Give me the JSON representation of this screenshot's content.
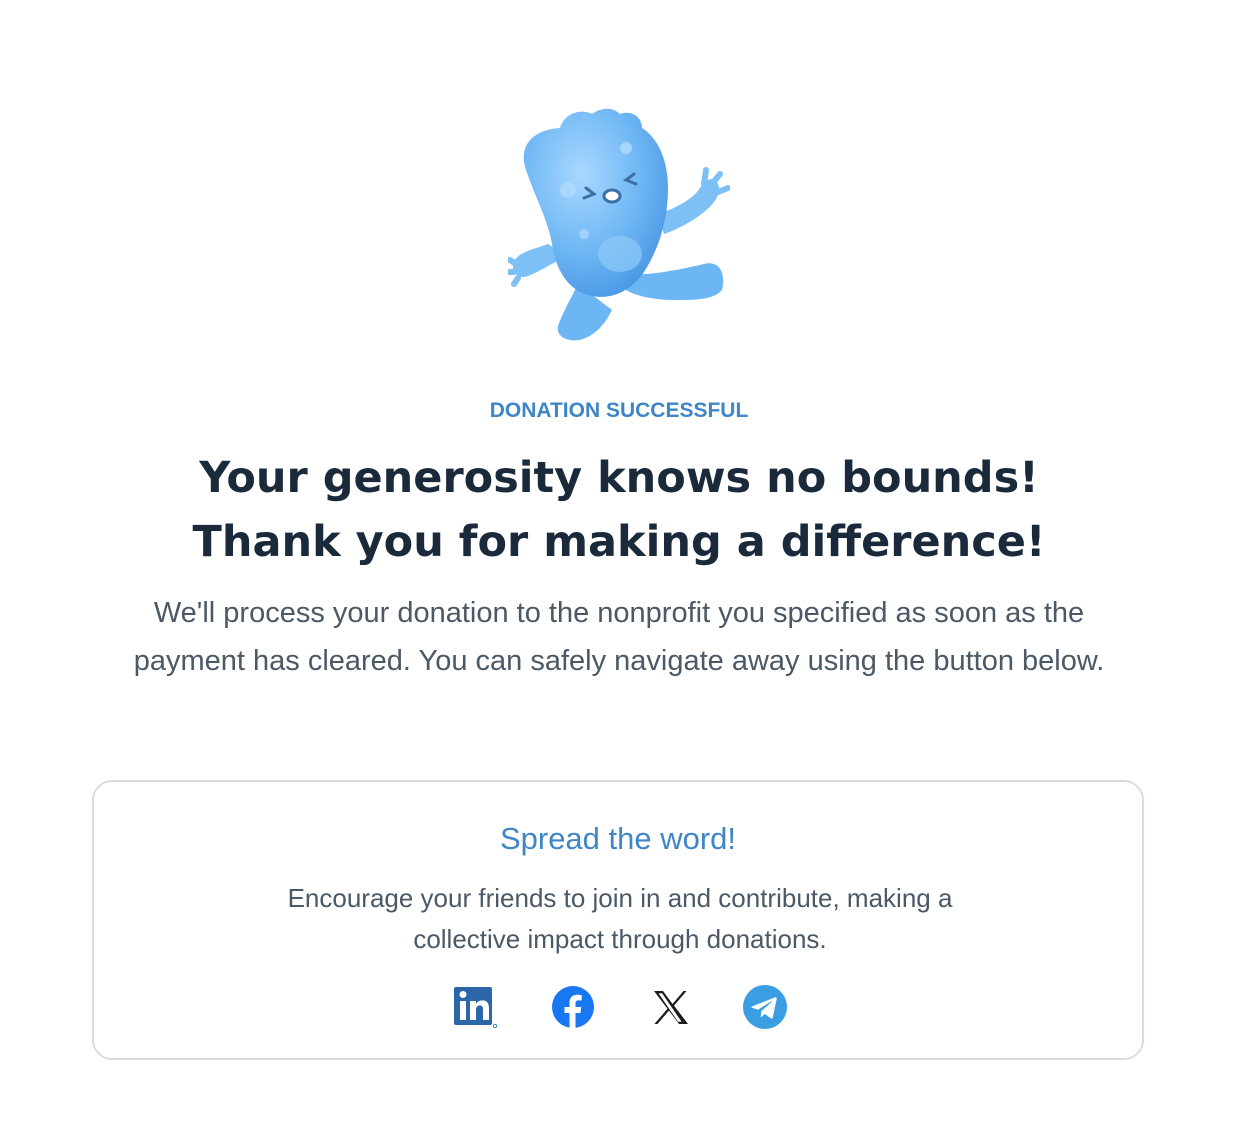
{
  "mascot": {
    "icon": "water-drop-mascot-cheering"
  },
  "status": {
    "eyebrow": "DONATION SUCCESSFUL"
  },
  "headline": {
    "line1": "Your generosity knows no bounds!",
    "line2": "Thank you for making a difference!"
  },
  "message": "We'll process your donation to the nonprofit you specified as soon as the payment has cleared. You can safely navigate away using the button below.",
  "share": {
    "title": "Spread the word!",
    "description": "Encourage your friends to join in and contribute, making a collective impact through donations.",
    "networks": [
      {
        "name": "LinkedIn",
        "icon": "linkedin-icon",
        "color": "#2a66a8"
      },
      {
        "name": "Facebook",
        "icon": "facebook-icon",
        "color": "#1877f2"
      },
      {
        "name": "X",
        "icon": "x-icon",
        "color": "#1a1a1a"
      },
      {
        "name": "Telegram",
        "icon": "telegram-icon",
        "color": "#3b9ee3"
      }
    ]
  },
  "colors": {
    "accent": "#3f86c7",
    "heading": "#1a2a3a",
    "body": "#4b5866",
    "card_border": "#d9dde2"
  }
}
